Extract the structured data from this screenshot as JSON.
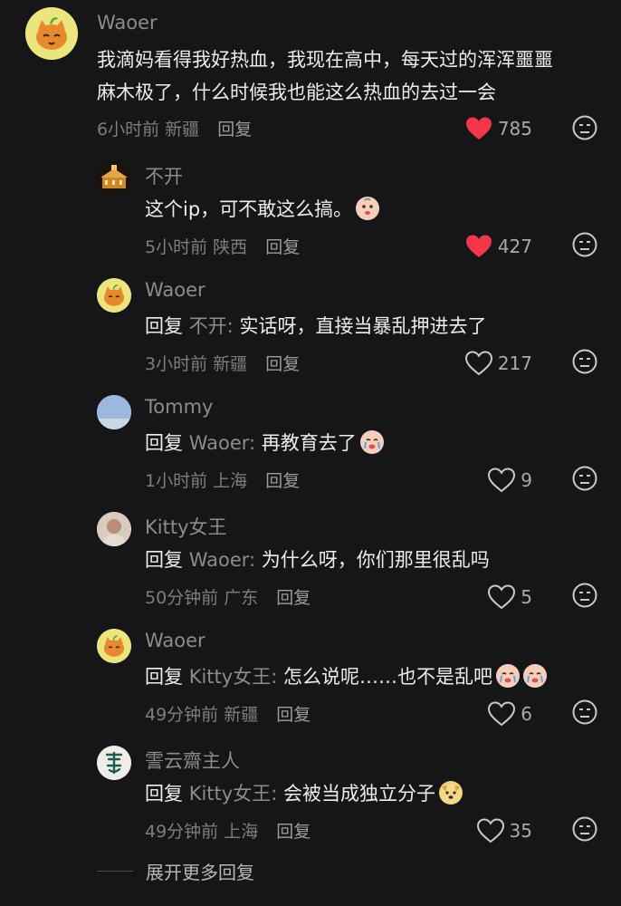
{
  "comments": [
    {
      "user": "Waoer",
      "avatar": "orange-cat-avatar",
      "lines": [
        "我滴妈看得我好热血，我现在高中，每天过的浑浑噩噩",
        "麻木极了，什么时候我也能这么热血的去过一会"
      ],
      "time": "6小时前",
      "location": "新疆",
      "reply_label": "回复",
      "likes": "785",
      "liked": true
    },
    {
      "user": "不开",
      "avatar": "night-building-avatar",
      "text": "这个ip，可不敢这么搞。",
      "emoji": "face-emoji",
      "time": "5小时前",
      "location": "陕西",
      "reply_label": "回复",
      "likes": "427",
      "liked": true
    },
    {
      "user": "Waoer",
      "avatar": "orange-cat-avatar",
      "reply_prefix": "回复",
      "reply_to": "不开:",
      "text": "实话呀，直接当暴乱押进去了",
      "time": "3小时前",
      "location": "新疆",
      "reply_label": "回复",
      "likes": "217",
      "liked": false
    },
    {
      "user": "Tommy",
      "avatar": "sky-avatar",
      "reply_prefix": "回复",
      "reply_to": "Waoer:",
      "text": "再教育去了",
      "emoji": "crying-face-emoji",
      "time": "1小时前",
      "location": "上海",
      "reply_label": "回复",
      "likes": "9",
      "liked": false
    },
    {
      "user": "Kitty女王",
      "avatar": "photo-avatar",
      "reply_prefix": "回复",
      "reply_to": "Waoer:",
      "text": "为什么呀，你们那里很乱吗",
      "time": "50分钟前",
      "location": "广东",
      "reply_label": "回复",
      "likes": "5",
      "liked": false
    },
    {
      "user": "Waoer",
      "avatar": "orange-cat-avatar",
      "reply_prefix": "回复",
      "reply_to": "Kitty女王:",
      "text": "怎么说呢……也不是乱吧",
      "emoji": "crying-faces-emoji",
      "time": "49分钟前",
      "location": "新疆",
      "reply_label": "回复",
      "likes": "6",
      "liked": false
    },
    {
      "user": "霅云齋主人",
      "avatar": "calligraphy-avatar",
      "reply_prefix": "回复",
      "reply_to": "Kitty女王:",
      "text": "会被当成独立分子",
      "emoji": "dog-face-emoji",
      "time": "49分钟前",
      "location": "上海",
      "reply_label": "回复",
      "likes": "35",
      "liked": false
    }
  ],
  "expand_label": "展开更多回复",
  "colors": {
    "liked": "#f2374a",
    "muted": "#7d7d82"
  }
}
